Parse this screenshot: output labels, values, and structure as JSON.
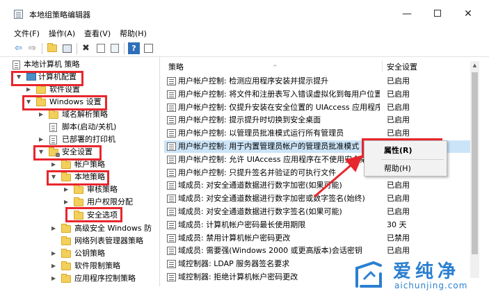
{
  "window": {
    "title": "本地组策略编辑器",
    "minimize_glyph": "—",
    "close_glyph": "✕"
  },
  "menubar": {
    "file": "文件(F)",
    "action": "操作(A)",
    "view": "查看(V)",
    "help": "帮助(H)"
  },
  "toolbar": {
    "back_glyph": "⇦",
    "forward_glyph": "⇨",
    "delete_glyph": "✖",
    "help_glyph": "?"
  },
  "tree": {
    "root": "本地计算机 策略",
    "computer_config": "计算机配置",
    "software_settings": "软件设置",
    "windows_settings": "Windows 设置",
    "dns_policy": "域名解析策略",
    "scripts": "脚本(启动/关机)",
    "deployed_printers": "已部署的打印机",
    "security_settings": "安全设置",
    "account_policies": "帐户策略",
    "local_policies": "本地策略",
    "audit_policy": "审核策略",
    "user_rights": "用户权限分配",
    "security_options": "安全选项",
    "advanced_firewall": "高级安全 Windows 防",
    "network_list": "网络列表管理器策略",
    "public_key": "公钥策略",
    "software_restriction": "软件限制策略",
    "app_control": "应用程序控制策略"
  },
  "policy_list": {
    "col_policy": "策略",
    "col_setting": "安全设置",
    "rows": [
      {
        "name": "用户帐户控制: 检测应用程序安装并提示提升",
        "setting": "已启用"
      },
      {
        "name": "用户帐户控制: 将文件和注册表写入错误虚拟化到每用户位置",
        "setting": "已启用"
      },
      {
        "name": "用户帐户控制: 仅提升安装在安全位置的 UIAccess 应用程序",
        "setting": "已启用"
      },
      {
        "name": "用户帐户控制: 提示提升时切换到安全桌面",
        "setting": "已启用"
      },
      {
        "name": "用户帐户控制: 以管理员批准模式运行所有管理员",
        "setting": "已启用"
      },
      {
        "name": "用户帐户控制: 用于内置管理员帐户的管理员批准模式",
        "setting": ""
      },
      {
        "name": "用户帐户控制: 允许 UIAccess 应用程序在不使用安全桌",
        "setting": ""
      },
      {
        "name": "用户帐户控制: 只提升签名并验证的可执行文件",
        "setting": ""
      },
      {
        "name": "域成员: 对安全通道数据进行数字加密(如果可能)",
        "setting": "已启用"
      },
      {
        "name": "域成员: 对安全通道数据进行数字加密或数字签名(始终)",
        "setting": "已启用"
      },
      {
        "name": "域成员: 对安全通道数据进行数字签名(如果可能)",
        "setting": "已启用"
      },
      {
        "name": "域成员: 计算机帐户密码最长使用期限",
        "setting": "30 天"
      },
      {
        "name": "域成员: 禁用计算机帐户密码更改",
        "setting": "已禁用"
      },
      {
        "name": "域成员: 需要强(Windows 2000 或更高版本)会话密钥",
        "setting": "已启用"
      },
      {
        "name": "域控制器: LDAP 服务器签名要求",
        "setting": ""
      },
      {
        "name": "域控制器: 拒绝计算机帐户密码更改",
        "setting": ""
      }
    ]
  },
  "context_menu": {
    "properties": "属性(R)",
    "help": "帮助(H)"
  },
  "watermark": {
    "name": "爱纯净",
    "url": "aichunjing.com"
  },
  "colors": {
    "highlight_red": "#e8262d",
    "selection_blue": "#cce4f7",
    "watermark_blue": "#2a7fd0"
  }
}
